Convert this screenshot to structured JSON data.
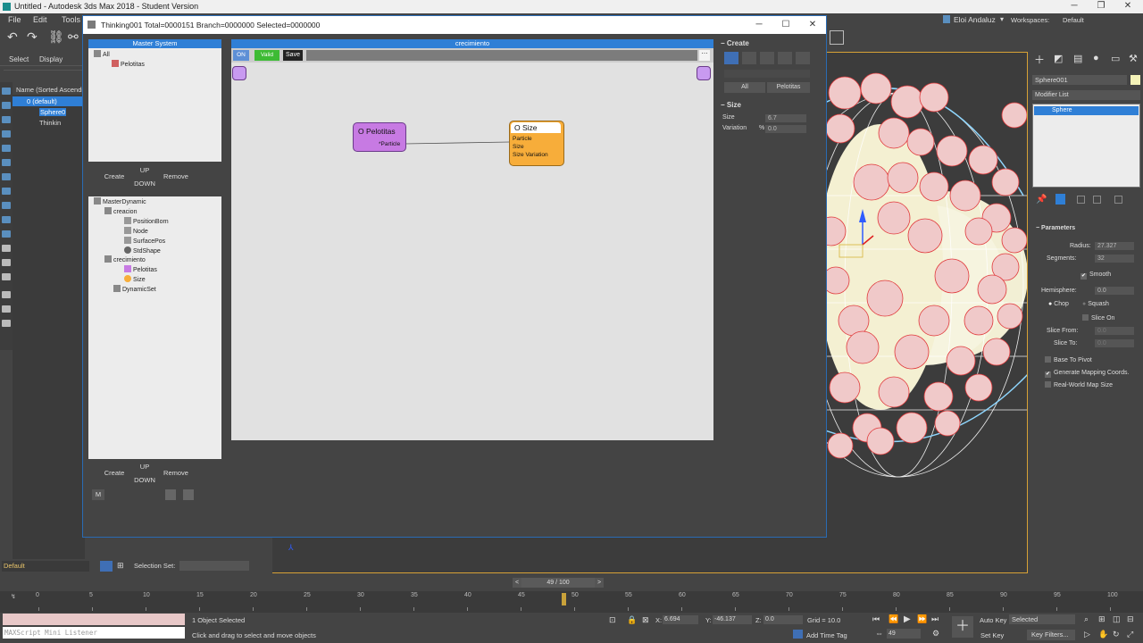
{
  "titlebar": {
    "title": "Untitled - Autodesk 3ds Max 2018 - Student Version"
  },
  "menu": {
    "items": [
      "File",
      "Edit",
      "Tools"
    ]
  },
  "user": {
    "name": "Eloi Andaluz",
    "workspaces_label": "Workspaces:",
    "workspace_value": "Default"
  },
  "scene_explorer": {
    "tabs": [
      "Select",
      "Display"
    ],
    "header": "Name (Sorted Ascendin",
    "rows": [
      "0 (default)",
      "Sphere0",
      "Thinkin"
    ]
  },
  "thinking": {
    "title": "Thinking001  Total=0000151  Branch=0000000  Selected=0000000",
    "master_system": {
      "header": "Master System",
      "tree": [
        "All",
        "Pelotitas"
      ],
      "buttons": {
        "create": "Create",
        "up": "UP",
        "down": "DOWN",
        "remove": "Remove"
      }
    },
    "master_dynamic": {
      "tree": [
        "MasterDynamic",
        "creacion",
        "PositionBorn",
        "Node",
        "SurfacePos",
        "StdShape",
        "crecimiento",
        "Pelotitas",
        "Size",
        "DynamicSet"
      ],
      "buttons": {
        "create": "Create",
        "up": "UP",
        "down": "DOWN",
        "remove": "Remove",
        "m": "M"
      }
    },
    "graph": {
      "header": "crecimiento",
      "toolbar": {
        "on": "ON",
        "valid": "Valid",
        "save": "Save"
      },
      "node_pelotitas": {
        "title": "O Pelotitas",
        "port": "*Particle"
      },
      "node_size": {
        "title": "O Size",
        "ports": [
          "Particle",
          "Size",
          "Size Variation"
        ]
      }
    },
    "create_panel": {
      "title": "Create",
      "tabs": [
        "All",
        "Pelotitas"
      ],
      "section": "Size",
      "size_label": "Size",
      "size_value": "6.7",
      "variation_label": "Variation",
      "variation_unit": "%",
      "variation_value": "0.0"
    }
  },
  "command_panel": {
    "object_name": "Sphere001",
    "modifier_list": "Modifier List",
    "stack_item": "Sphere",
    "parameters": {
      "title": "Parameters",
      "radius_label": "Radius:",
      "radius_value": "27.327",
      "segments_label": "Segments:",
      "segments_value": "32",
      "smooth": "Smooth",
      "hemisphere_label": "Hemisphere:",
      "hemisphere_value": "0.0",
      "chop": "Chop",
      "squash": "Squash",
      "slice_on": "Slice On",
      "slice_from_label": "Slice From:",
      "slice_from_value": "0.0",
      "slice_to_label": "Slice To:",
      "slice_to_value": "0.0",
      "base_to_pivot": "Base To Pivot",
      "gen_mapping": "Generate Mapping Coords.",
      "real_world": "Real-World Map Size"
    }
  },
  "layer": {
    "name": "Default",
    "selection_set_label": "Selection Set:"
  },
  "time": {
    "slider_text": "49 / 100",
    "ticks": [
      "0",
      "5",
      "10",
      "15",
      "20",
      "25",
      "30",
      "35",
      "40",
      "45",
      "50",
      "55",
      "60",
      "65",
      "70",
      "75",
      "80",
      "85",
      "90",
      "95",
      "100"
    ]
  },
  "status": {
    "listener": "MAXScript Mini Listener",
    "selected": "1 Object Selected",
    "prompt": "Click and drag to select and move objects",
    "x_label": "X:",
    "x_value": "6.694",
    "y_label": "Y:",
    "y_value": "-46.137",
    "z_label": "Z:",
    "z_value": "0.0",
    "grid": "Grid = 10.0",
    "add_time_tag": "Add Time Tag",
    "frame_value": "49",
    "auto_key": "Auto Key",
    "set_key": "Set Key",
    "key_mode": "Selected",
    "key_filters": "Key Filters..."
  },
  "colors": {
    "accent": "#2f7fd6",
    "viewport_border": "#d8a236",
    "node_purple": "#c77ae3",
    "node_orange": "#f7ad3a",
    "valid_green": "#3dbb34"
  }
}
